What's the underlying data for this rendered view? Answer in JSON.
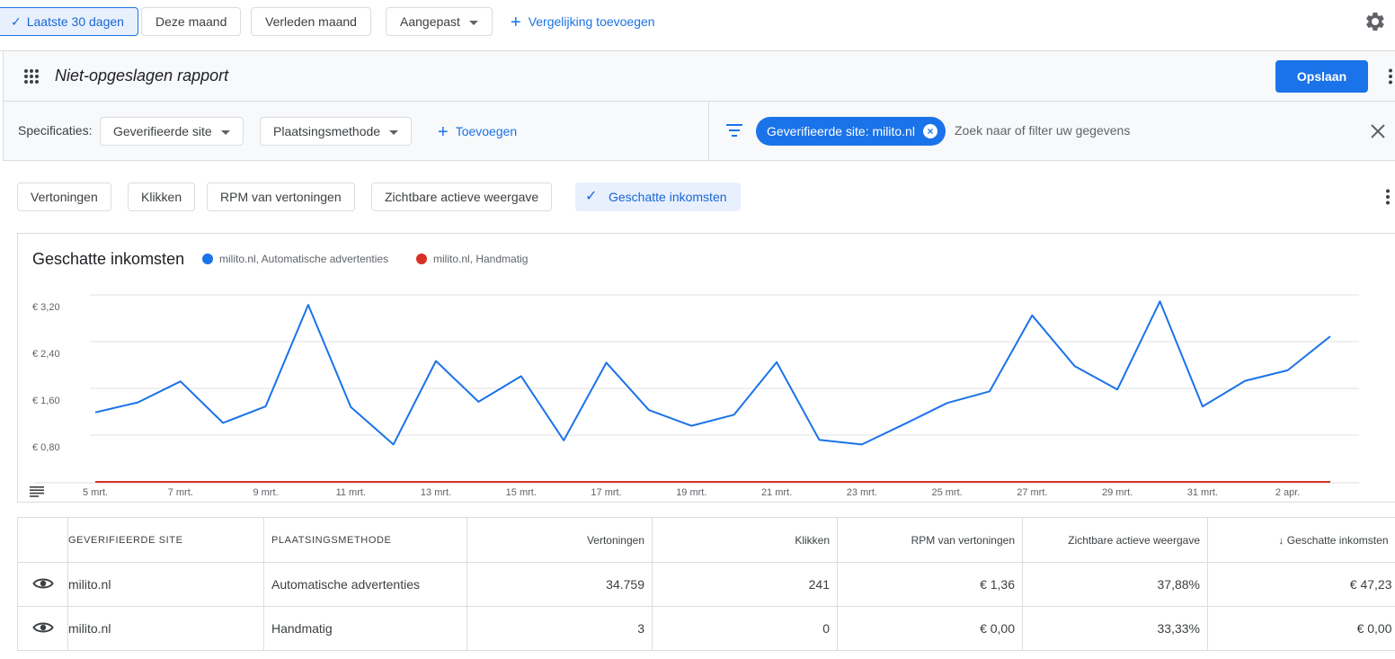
{
  "datebar": {
    "chips": [
      {
        "label": "Laatste 30 dagen",
        "active": true
      },
      {
        "label": "Deze maand",
        "active": false
      },
      {
        "label": "Verleden maand",
        "active": false
      },
      {
        "label": "Aangepast",
        "active": false
      }
    ],
    "add_comparison": "Vergelijking toevoegen",
    "check_glyph": "✓",
    "plus_glyph": "+"
  },
  "report": {
    "title": "Niet-opgeslagen rapport",
    "save_label": "Opslaan"
  },
  "filters": {
    "spec_label": "Specificaties:",
    "dimensions": [
      "Geverifieerde site",
      "Plaatsingsmethode"
    ],
    "add_label": "Toevoegen",
    "active_filter": "Geverifieerde site: milito.nl",
    "search_placeholder": "Zoek naar of filter uw gegevens"
  },
  "metrics": {
    "chips": [
      {
        "label": "Vertoningen",
        "selected": false
      },
      {
        "label": "Klikken",
        "selected": false
      },
      {
        "label": "RPM van vertoningen",
        "selected": false
      },
      {
        "label": "Zichtbare actieve weergave",
        "selected": false
      },
      {
        "label": "Geschatte inkomsten",
        "selected": true
      }
    ]
  },
  "colors": {
    "accent": "#1a73e8",
    "series_auto": "#1a73e8",
    "series_manual": "#d93025"
  },
  "chart_data": {
    "type": "line",
    "title": "Geschatte inkomsten",
    "x_tick_labels": [
      "5 mrt.",
      "7 mrt.",
      "9 mrt.",
      "11 mrt.",
      "13 mrt.",
      "15 mrt.",
      "17 mrt.",
      "19 mrt.",
      "21 mrt.",
      "23 mrt.",
      "25 mrt.",
      "27 mrt.",
      "29 mrt.",
      "31 mrt.",
      "2 apr."
    ],
    "y_tick_labels": [
      "€ 3,20",
      "€ 2,40",
      "€ 1,60",
      "€ 0,80"
    ],
    "y_ticks": [
      3.2,
      2.4,
      1.6,
      0.8
    ],
    "ylim": [
      0,
      3.2
    ],
    "x_range": [
      "5 mrt.",
      "3 apr."
    ],
    "grid": true,
    "legend_position": "top",
    "series": [
      {
        "name": "milito.nl, Automatische advertenties",
        "color": "#1a73e8",
        "values": [
          1.19,
          1.36,
          1.72,
          1.01,
          1.29,
          3.03,
          1.28,
          0.64,
          2.07,
          1.37,
          1.81,
          0.71,
          2.04,
          1.23,
          0.96,
          1.15,
          2.05,
          0.72,
          0.64,
          0.99,
          1.35,
          1.55,
          2.85,
          1.98,
          1.58,
          3.09,
          1.29,
          1.73,
          1.91,
          2.49
        ]
      },
      {
        "name": "milito.nl, Handmatig",
        "color": "#d93025",
        "values": [
          0,
          0,
          0,
          0,
          0,
          0,
          0,
          0,
          0,
          0,
          0,
          0,
          0,
          0,
          0,
          0,
          0,
          0,
          0,
          0,
          0,
          0,
          0,
          0,
          0,
          0,
          0,
          0,
          0,
          0
        ]
      }
    ]
  },
  "table": {
    "headers": [
      "GEVERIFIEERDE SITE",
      "PLAATSINGSMETHODE",
      "Vertoningen",
      "Klikken",
      "RPM van vertoningen",
      "Zichtbare actieve weergave",
      "Geschatte inkomsten"
    ],
    "sort_arrow": "↓",
    "rows": [
      {
        "site": "milito.nl",
        "method": "Automatische advertenties",
        "impressions": "34.759",
        "clicks": "241",
        "rpm": "€ 1,36",
        "viewable": "37,88%",
        "earnings": "€ 47,23"
      },
      {
        "site": "milito.nl",
        "method": "Handmatig",
        "impressions": "3",
        "clicks": "0",
        "rpm": "€ 0,00",
        "viewable": "33,33%",
        "earnings": "€ 0,00"
      }
    ]
  }
}
